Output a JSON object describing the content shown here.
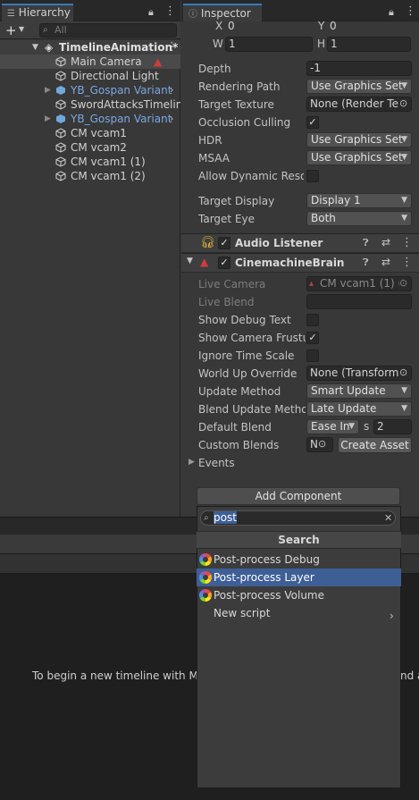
{
  "hierarchy": {
    "tab_label": "Hierarchy",
    "search_placeholder": "All",
    "root": "TimelineAnimation*",
    "items": [
      {
        "label": "Main Camera"
      },
      {
        "label": "Directional Light"
      },
      {
        "label": "YB_Gospan Variant"
      },
      {
        "label": "SwordAttacksTimeline"
      },
      {
        "label": "YB_Gospan Variant"
      },
      {
        "label": "CM vcam1"
      },
      {
        "label": "CM vcam2"
      },
      {
        "label": "CM vcam1 (1)"
      },
      {
        "label": "CM vcam1 (2)"
      }
    ]
  },
  "inspector": {
    "tab_label": "Inspector",
    "viewport": {
      "x_label": "X",
      "x_value": "0",
      "y_label": "Y",
      "y_value": "0",
      "w_label": "W",
      "w_value": "1",
      "h_label": "H",
      "h_value": "1"
    },
    "camera_fields": {
      "depth_label": "Depth",
      "depth_value": "-1",
      "rendering_path_label": "Rendering Path",
      "rendering_path_value": "Use Graphics Set",
      "target_texture_label": "Target Texture",
      "target_texture_value": "None (Render Te",
      "occlusion_culling_label": "Occlusion Culling",
      "hdr_label": "HDR",
      "hdr_value": "Use Graphics Set",
      "msaa_label": "MSAA",
      "msaa_value": "Use Graphics Set",
      "allow_dynamic_label": "Allow Dynamic Resol",
      "target_display_label": "Target Display",
      "target_display_value": "Display 1",
      "target_eye_label": "Target Eye",
      "target_eye_value": "Both"
    },
    "audio_listener": {
      "title": "Audio Listener"
    },
    "cinemachine_brain": {
      "title": "CinemachineBrain",
      "live_camera_label": "Live Camera",
      "live_camera_value": "CM vcam1 (1) (",
      "live_blend_label": "Live Blend",
      "show_debug_label": "Show Debug Text",
      "show_frustum_label": "Show Camera Frustur",
      "ignore_time_label": "Ignore Time Scale",
      "world_up_label": "World Up Override",
      "world_up_value": "None (Transform)",
      "update_method_label": "Update Method",
      "update_method_value": "Smart Update",
      "blend_update_label": "Blend Update Methoc",
      "blend_update_value": "Late Update",
      "default_blend_label": "Default Blend",
      "default_blend_value": "Ease In",
      "default_blend_s_label": "s",
      "default_blend_s_value": "2",
      "custom_blends_label": "Custom Blends",
      "custom_blends_value": "N",
      "create_asset_label": "Create Asset",
      "events_label": "Events"
    }
  },
  "add_component": {
    "button_label": "Add Component",
    "search_value": "post",
    "section_title": "Search",
    "results": [
      {
        "label": "Post-process Debug"
      },
      {
        "label": "Post-process Layer"
      },
      {
        "label": "Post-process Volume"
      }
    ],
    "new_script_label": "New script"
  },
  "timeline": {
    "message_left": "To begin a new timeline with Mai",
    "message_right": "nd a"
  }
}
